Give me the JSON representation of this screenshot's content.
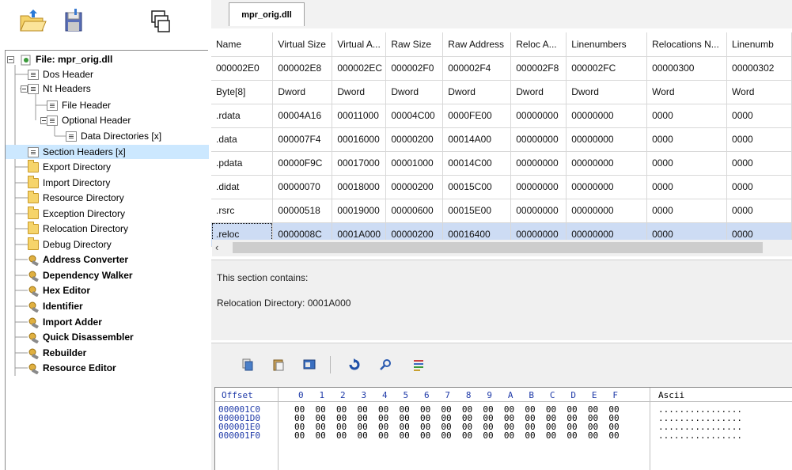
{
  "document_tab": "mpr_orig.dll",
  "tree": {
    "root": "File: mpr_orig.dll",
    "nodes": [
      "Dos Header",
      "Nt Headers",
      "File Header",
      "Optional Header",
      "Data Directories [x]",
      "Section Headers [x]",
      "Export Directory",
      "Import Directory",
      "Resource Directory",
      "Exception Directory",
      "Relocation Directory",
      "Debug Directory",
      "Address Converter",
      "Dependency Walker",
      "Hex Editor",
      "Identifier",
      "Import Adder",
      "Quick Disassembler",
      "Rebuilder",
      "Resource Editor"
    ],
    "selected": "Section Headers [x]"
  },
  "grid": {
    "columns": [
      "Name",
      "Virtual Size",
      "Virtual A...",
      "Raw Size",
      "Raw Address",
      "Reloc A...",
      "Linenumbers",
      "Relocations N...",
      "Linenumb"
    ],
    "offsets": [
      "000002E0",
      "000002E8",
      "000002EC",
      "000002F0",
      "000002F4",
      "000002F8",
      "000002FC",
      "00000300",
      "00000302"
    ],
    "types": [
      "Byte[8]",
      "Dword",
      "Dword",
      "Dword",
      "Dword",
      "Dword",
      "Dword",
      "Word",
      "Word"
    ],
    "rows": [
      [
        ".rdata",
        "00004A16",
        "00011000",
        "00004C00",
        "0000FE00",
        "00000000",
        "00000000",
        "0000",
        "0000"
      ],
      [
        ".data",
        "000007F4",
        "00016000",
        "00000200",
        "00014A00",
        "00000000",
        "00000000",
        "0000",
        "0000"
      ],
      [
        ".pdata",
        "00000F9C",
        "00017000",
        "00001000",
        "00014C00",
        "00000000",
        "00000000",
        "0000",
        "0000"
      ],
      [
        ".didat",
        "00000070",
        "00018000",
        "00000200",
        "00015C00",
        "00000000",
        "00000000",
        "0000",
        "0000"
      ],
      [
        ".rsrc",
        "00000518",
        "00019000",
        "00000600",
        "00015E00",
        "00000000",
        "00000000",
        "0000",
        "0000"
      ],
      [
        ".reloc",
        "0000008C",
        "0001A000",
        "00000200",
        "00016400",
        "00000000",
        "00000000",
        "0000",
        "0000"
      ]
    ],
    "selected_row": ".reloc"
  },
  "info": {
    "line1": "This section contains:",
    "line2": "Relocation Directory: 0001A000"
  },
  "hex": {
    "header_offset": "Offset",
    "header_bytes": "0   1   2   3   4   5   6   7   8   9   A   B   C   D   E   F",
    "header_ascii": "Ascii",
    "offsets": "000001C0\n000001D0\n000001E0\n000001F0",
    "bytes": "00  00  00  00  00  00  00  00  00  00  00  00  00  00  00  00\n00  00  00  00  00  00  00  00  00  00  00  00  00  00  00  00\n00  00  00  00  00  00  00  00  00  00  00  00  00  00  00  00\n00  00  00  00  00  00  00  00  00  00  00  00  00  00  00  00",
    "ascii": "................\n................\n................\n................"
  },
  "colors": {
    "selection": "#cce8ff",
    "grid_selection": "#cddcf4",
    "hex_blue": "#1f3aa8"
  }
}
